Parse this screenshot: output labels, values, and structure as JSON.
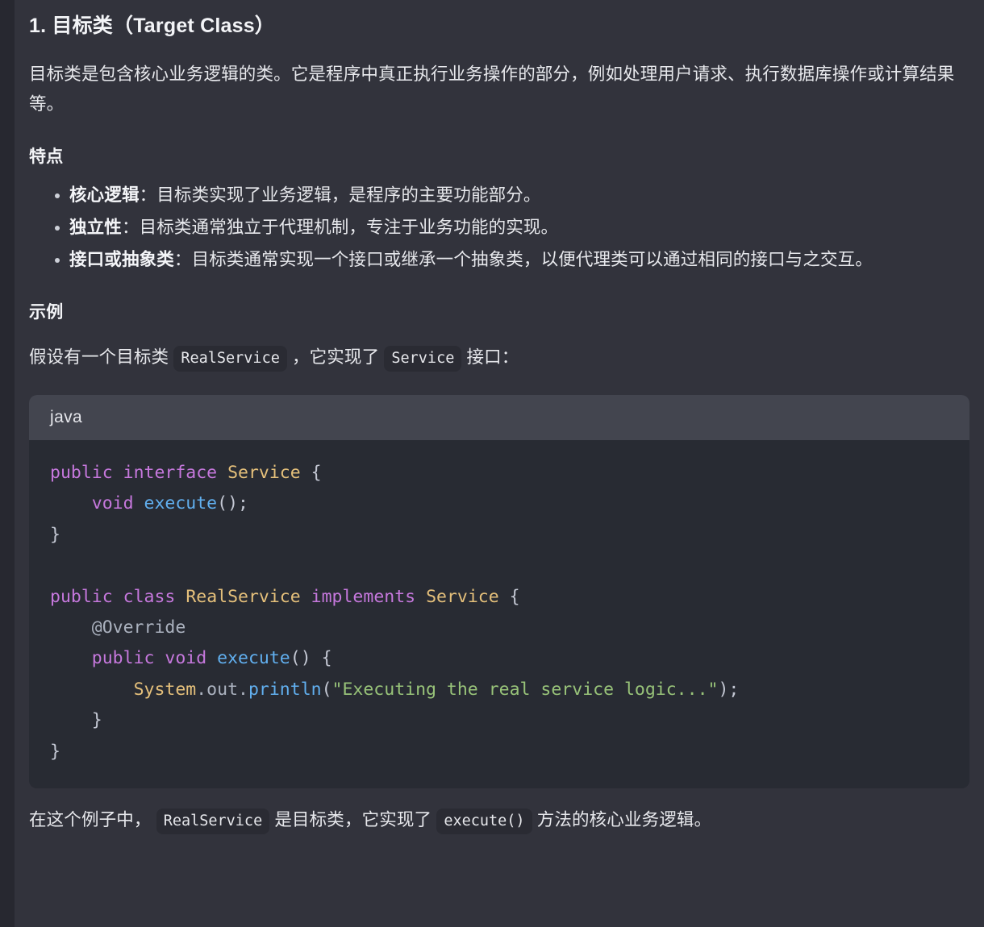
{
  "section": {
    "heading": "1. 目标类（Target Class）",
    "intro_paragraph": "目标类是包含核心业务逻辑的类。它是程序中真正执行业务操作的部分，例如处理用户请求、执行数据库操作或计算结果等。"
  },
  "features": {
    "heading": "特点",
    "items": [
      {
        "term": "核心逻辑",
        "separator": "：",
        "description": "目标类实现了业务逻辑，是程序的主要功能部分。"
      },
      {
        "term": "独立性",
        "separator": "：",
        "description": "目标类通常独立于代理机制，专注于业务功能的实现。"
      },
      {
        "term": "接口或抽象类",
        "separator": "：",
        "description": "目标类通常实现一个接口或继承一个抽象类，以便代理类可以通过相同的接口与之交互。"
      }
    ]
  },
  "example": {
    "heading": "示例",
    "lead_part1": "假设有一个目标类",
    "lead_code1": "RealService",
    "lead_part2": "，它实现了",
    "lead_code2": "Service",
    "lead_part3": "接口："
  },
  "code_block": {
    "language_label": "java",
    "lines": [
      [
        {
          "t": "public",
          "c": "tok-kw"
        },
        {
          "t": " ",
          "c": "tok-plain"
        },
        {
          "t": "interface",
          "c": "tok-kw"
        },
        {
          "t": " ",
          "c": "tok-plain"
        },
        {
          "t": "Service",
          "c": "tok-type"
        },
        {
          "t": " {",
          "c": "tok-punc"
        }
      ],
      [
        {
          "t": "    ",
          "c": "tok-plain"
        },
        {
          "t": "void",
          "c": "tok-kw"
        },
        {
          "t": " ",
          "c": "tok-plain"
        },
        {
          "t": "execute",
          "c": "tok-fn"
        },
        {
          "t": "();",
          "c": "tok-punc"
        }
      ],
      [
        {
          "t": "}",
          "c": "tok-punc"
        }
      ],
      [],
      [
        {
          "t": "public",
          "c": "tok-kw"
        },
        {
          "t": " ",
          "c": "tok-plain"
        },
        {
          "t": "class",
          "c": "tok-kw"
        },
        {
          "t": " ",
          "c": "tok-plain"
        },
        {
          "t": "RealService",
          "c": "tok-type"
        },
        {
          "t": " ",
          "c": "tok-plain"
        },
        {
          "t": "implements",
          "c": "tok-kw"
        },
        {
          "t": " ",
          "c": "tok-plain"
        },
        {
          "t": "Service",
          "c": "tok-type"
        },
        {
          "t": " {",
          "c": "tok-punc"
        }
      ],
      [
        {
          "t": "    ",
          "c": "tok-plain"
        },
        {
          "t": "@Override",
          "c": "tok-anno"
        }
      ],
      [
        {
          "t": "    ",
          "c": "tok-plain"
        },
        {
          "t": "public",
          "c": "tok-kw"
        },
        {
          "t": " ",
          "c": "tok-plain"
        },
        {
          "t": "void",
          "c": "tok-kw"
        },
        {
          "t": " ",
          "c": "tok-plain"
        },
        {
          "t": "execute",
          "c": "tok-fn"
        },
        {
          "t": "() {",
          "c": "tok-punc"
        }
      ],
      [
        {
          "t": "        ",
          "c": "tok-plain"
        },
        {
          "t": "System",
          "c": "tok-type"
        },
        {
          "t": ".out.",
          "c": "tok-anno"
        },
        {
          "t": "println",
          "c": "tok-fn"
        },
        {
          "t": "(",
          "c": "tok-punc"
        },
        {
          "t": "\"Executing the real service logic...\"",
          "c": "tok-str"
        },
        {
          "t": ");",
          "c": "tok-punc"
        }
      ],
      [
        {
          "t": "    }",
          "c": "tok-punc"
        }
      ],
      [
        {
          "t": "}",
          "c": "tok-punc"
        }
      ]
    ]
  },
  "closing": {
    "part1": "在这个例子中，",
    "code1": "RealService",
    "part2": "是目标类，它实现了",
    "code2": "execute()",
    "part3": "方法的核心业务逻辑。"
  },
  "colors": {
    "page_background": "#32333c",
    "edge_strip": "#272830",
    "code_header_background": "#43454f",
    "code_body_background": "#282b33",
    "inline_code_background": "#2a2b33",
    "text": "#e7e8ec",
    "keyword": "#c678dd",
    "type": "#e5c07b",
    "function": "#61afef",
    "string": "#98c379",
    "annotation": "#abb2bf"
  }
}
